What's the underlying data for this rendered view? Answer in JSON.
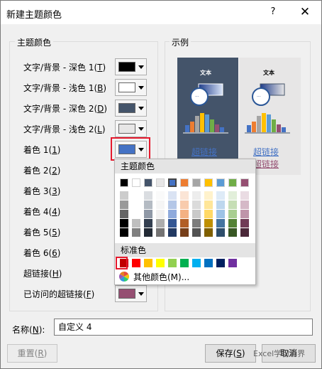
{
  "window": {
    "title": "新建主题颜色",
    "help": "?",
    "close": "✕"
  },
  "theme_group": {
    "title": "主题颜色",
    "rows": [
      {
        "label": "文字/背景 - 深色 1",
        "key": "T",
        "color": "#000000"
      },
      {
        "label": "文字/背景 - 浅色 1",
        "key": "B",
        "color": "#ffffff"
      },
      {
        "label": "文字/背景 - 深色 2",
        "key": "D",
        "color": "#44546a"
      },
      {
        "label": "文字/背景 - 浅色 2",
        "key": "L",
        "color": "#e7e6e6"
      },
      {
        "label": "着色 1",
        "key": "1",
        "color": "#4472c4"
      },
      {
        "label": "着色 2",
        "key": "2"
      },
      {
        "label": "着色 3",
        "key": "3"
      },
      {
        "label": "着色 4",
        "key": "4"
      },
      {
        "label": "着色 5",
        "key": "5"
      },
      {
        "label": "着色 6",
        "key": "6"
      },
      {
        "label": "超链接",
        "key": "H"
      },
      {
        "label": "已访问的超链接",
        "key": "F",
        "color": "#954f72"
      }
    ]
  },
  "sample_group": {
    "title": "示例",
    "text_label": "文本",
    "hyperlink": "超链接",
    "visited": "超链接"
  },
  "palette": {
    "theme_title": "主题颜色",
    "standard_title": "标准色",
    "more_colors": "其他颜色(M)...",
    "theme_colors": [
      "#000000",
      "#ffffff",
      "#44546a",
      "#e7e6e6",
      "#4472c4",
      "#ed7d31",
      "#a5a5a5",
      "#ffc000",
      "#5b9bd5",
      "#70ad47",
      "#954f72"
    ],
    "standard_colors": [
      "#c00000",
      "#ff0000",
      "#ffc000",
      "#ffff00",
      "#92d050",
      "#00b050",
      "#00b0f0",
      "#0070c0",
      "#002060",
      "#7030a0"
    ]
  },
  "name": {
    "label": "名称",
    "key": "N",
    "value": "自定义 4"
  },
  "buttons": {
    "reset": "重置",
    "reset_key": "R",
    "save": "保存",
    "save_key": "S",
    "cancel": "取消"
  },
  "watermark": "Excel学习世界"
}
